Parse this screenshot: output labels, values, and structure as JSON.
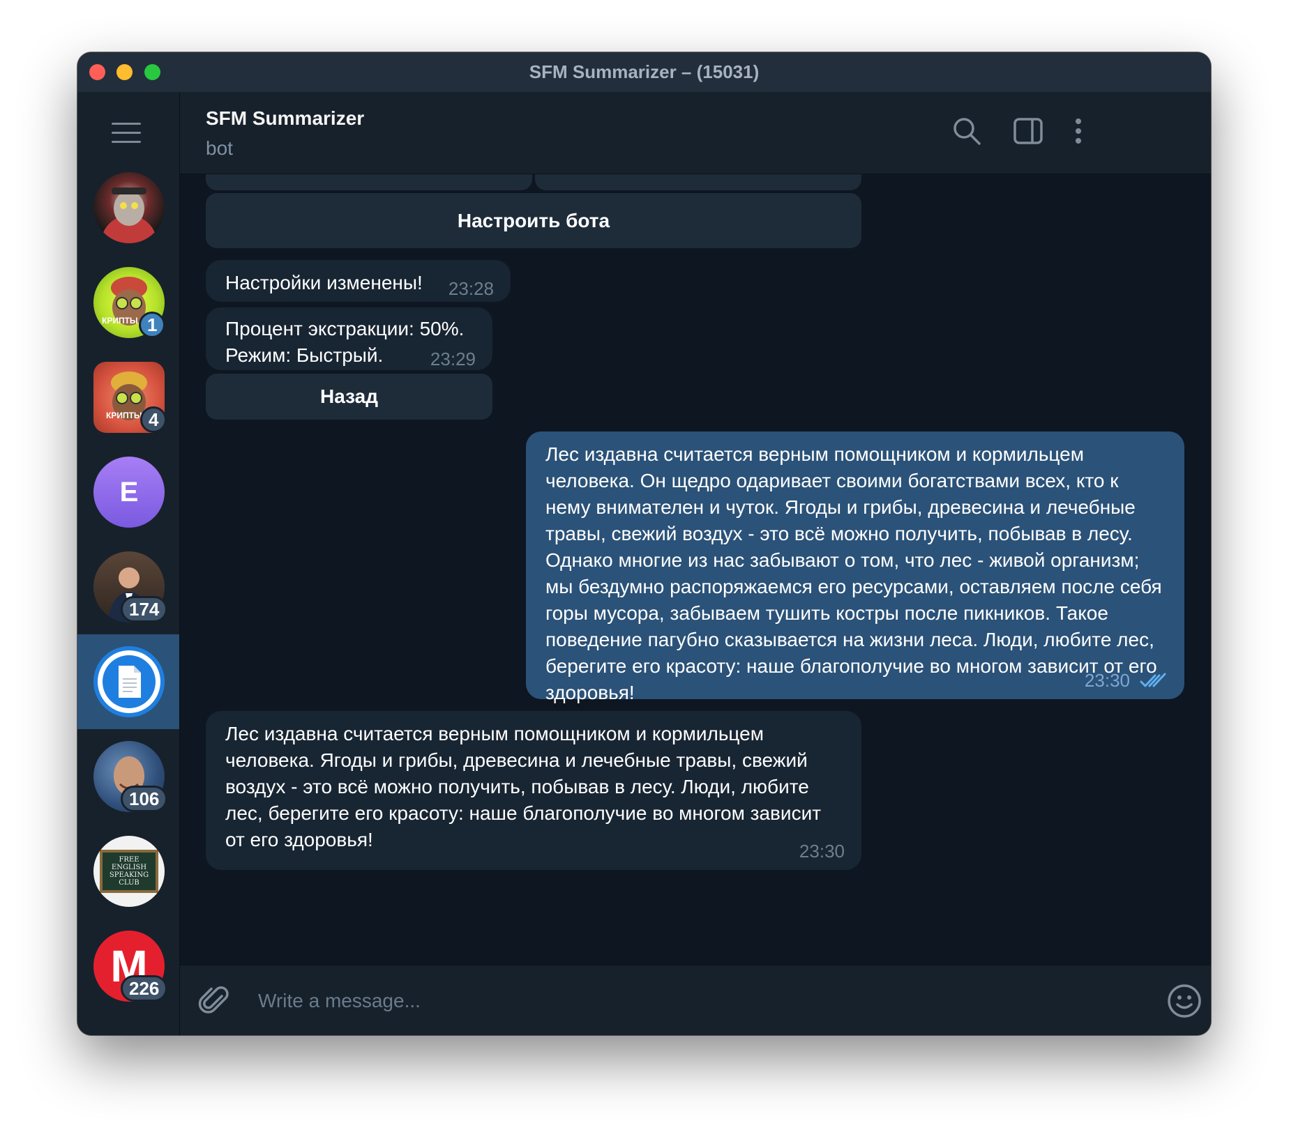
{
  "window": {
    "title": "SFM Summarizer – (15031)"
  },
  "sidebar": {
    "chats": [
      {
        "name": "ape-avatar-1",
        "badge": ""
      },
      {
        "name": "ape-avatar-2",
        "avatar_text": "КРИПТЫ",
        "badge": "1",
        "badge_color": "#4082bc"
      },
      {
        "name": "ape-avatar-3",
        "avatar_text": "КРИПТЫ",
        "badge": "4"
      },
      {
        "name": "e-avatar",
        "avatar_text": "E",
        "badge": ""
      },
      {
        "name": "man-avatar",
        "badge": "174"
      },
      {
        "name": "sfm-summarizer-avatar",
        "badge": "",
        "active": true
      },
      {
        "name": "elon-avatar",
        "badge": "106"
      },
      {
        "name": "english-club-avatar",
        "avatar_text": "FREE ENGLISH SPEAKING CLUB",
        "badge": ""
      },
      {
        "name": "m-avatar",
        "avatar_text": "M",
        "badge": "226"
      }
    ]
  },
  "header": {
    "name": "SFM Summarizer",
    "status": "bot"
  },
  "messages": {
    "keyboard_top": {
      "configure": "Настроить бота"
    },
    "settings_changed": {
      "text": "Настройки изменены!",
      "time": "23:28"
    },
    "settings_info": {
      "line1": "Процент экстракции: 50%.",
      "line2": "Режим: Быстрый.",
      "time": "23:29"
    },
    "back_button": "Назад",
    "outgoing": {
      "text": "Лес издавна считается верным помощником и кормильцем человека. Он щедро одаривает своими богатствами всех, кто к нему внимателен и чуток. Ягоды и грибы, древесина и лечебные травы, свежий воздух - это всё можно получить, побывав в лесу. Однако многие из нас забывают о том, что лес - живой организм; мы бездумно распоряжаемся его ресурсами, оставляем после себя горы мусора, забываем тушить костры после пикников. Такое поведение пагубно сказывается на жизни леса. Люди, любите лес, берегите его красоту: наше благополучие во многом зависит от его здоровья!",
      "time": "23:30"
    },
    "summary": {
      "text": "Лес издавна считается верным помощником и кормильцем человека. Ягоды и грибы, древесина и лечебные травы, свежий воздух - это всё можно получить, побывав в лесу. Люди, любите лес, берегите его красоту: наше благополучие во многом зависит от его здоровья!",
      "time": "23:30"
    }
  },
  "composer": {
    "placeholder": "Write a message..."
  },
  "colors": {
    "window_bg": "#0e1621",
    "panel_bg": "#17212b",
    "bubble_in": "#182533",
    "bubble_out": "#2b5278",
    "active_chat": "#2b5278",
    "badge": "#3e5369",
    "badge_unmuted": "#4082bc"
  }
}
